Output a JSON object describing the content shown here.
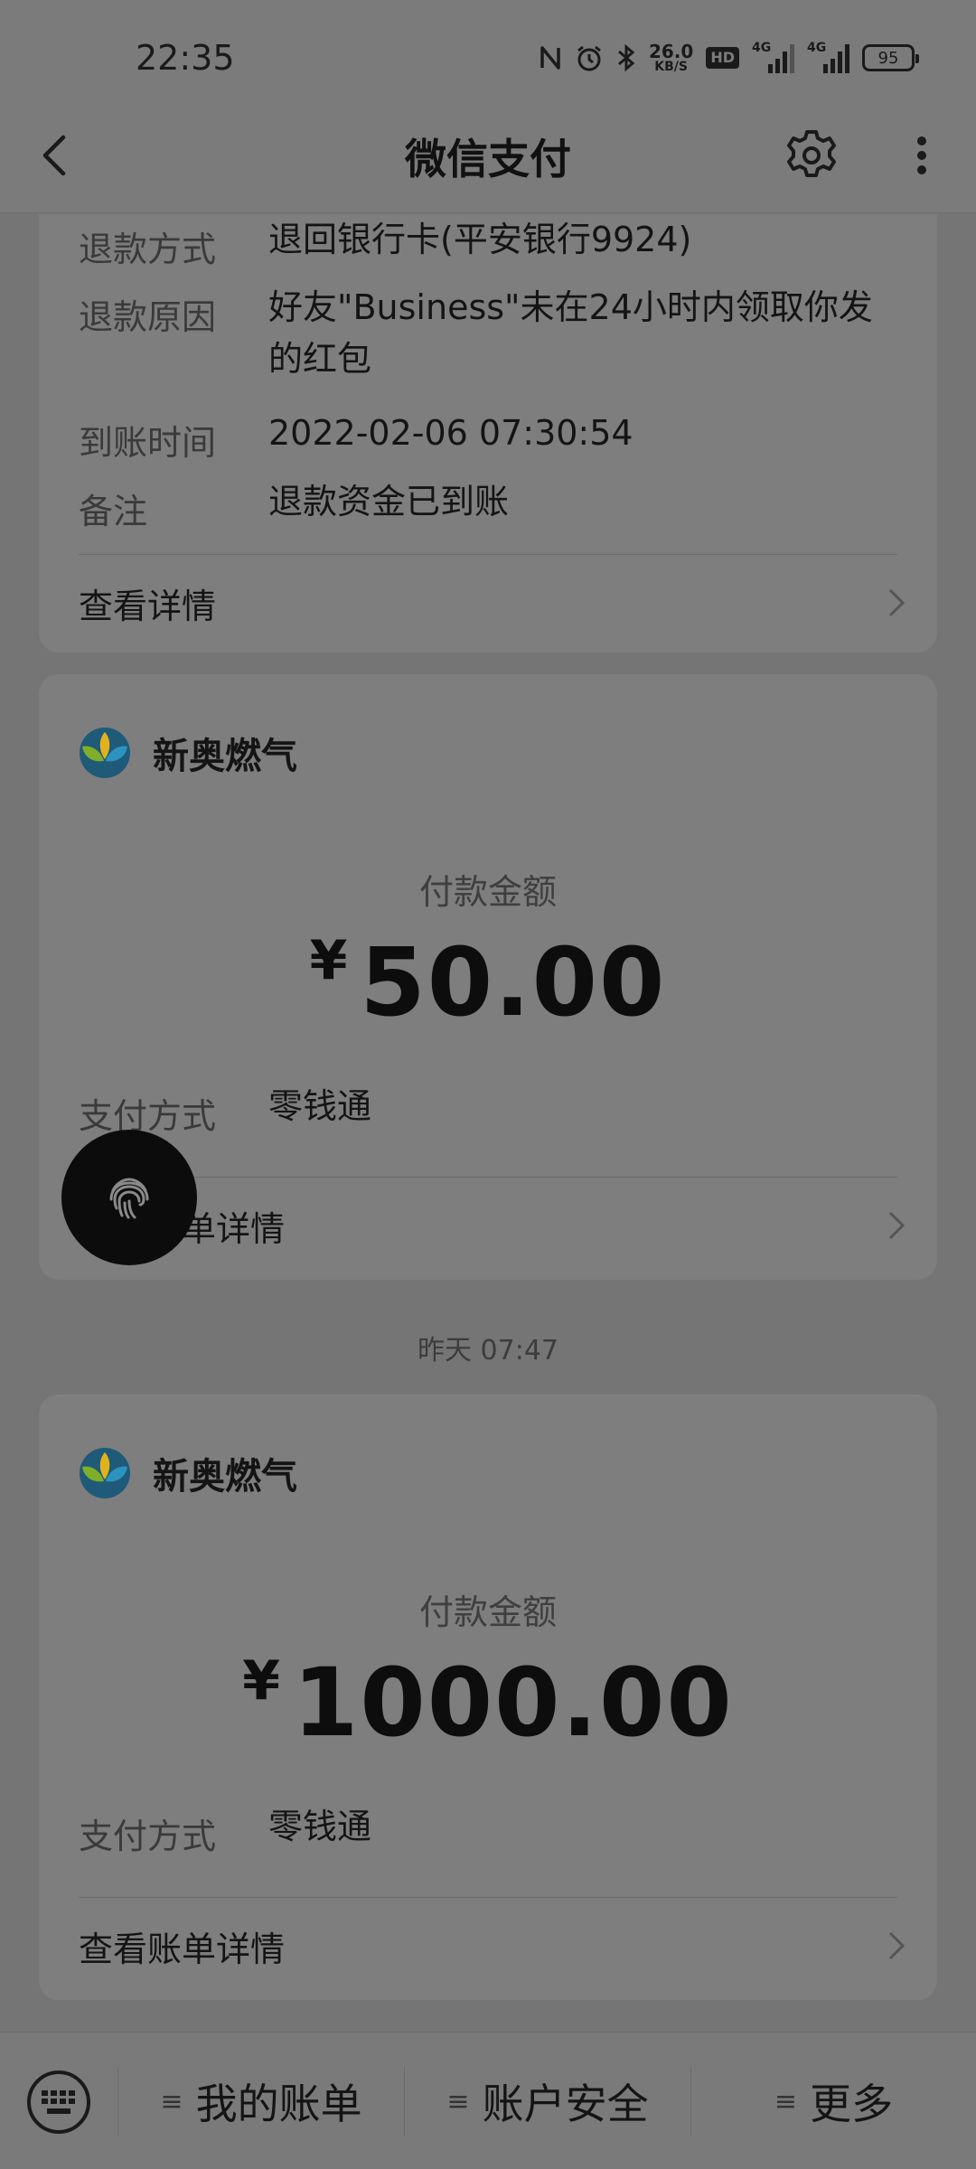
{
  "status_bar": {
    "time": "22:35",
    "net_speed_value": "26.0",
    "net_speed_unit": "KB/S",
    "hd_badge": "HD",
    "signal1_tag": "4G",
    "signal2_tag": "4G",
    "battery_level": "95",
    "icons": [
      "nfc-icon",
      "alarm-icon",
      "bluetooth-icon",
      "net-speed",
      "hd-icon",
      "signal-icon",
      "signal-icon",
      "battery-icon"
    ]
  },
  "header": {
    "title": "微信支付",
    "back_icon": "back-arrow-icon",
    "settings_icon": "gear-icon",
    "more_icon": "more-vertical-icon"
  },
  "refund_card": {
    "rows": [
      {
        "label": "退款方式",
        "value": "退回银行卡(平安银行9924)"
      },
      {
        "label": "退款原因",
        "value": "好友\"Business\"未在24小时内领取你发的红包"
      },
      {
        "label": "到账时间",
        "value": "2022-02-06 07:30:54"
      },
      {
        "label": "备注",
        "value": "退款资金已到账"
      }
    ],
    "link": "查看详情"
  },
  "payment_card_1": {
    "merchant": "新奥燃气",
    "amount_label": "付款金额",
    "currency": "¥",
    "amount": "50.00",
    "method_label": "支付方式",
    "method_value": "零钱通",
    "link": "查看账单详情"
  },
  "timestamp": "昨天 07:47",
  "payment_card_2": {
    "merchant": "新奥燃气",
    "amount_label": "付款金额",
    "currency": "¥",
    "amount": "1000.00",
    "method_label": "支付方式",
    "method_value": "零钱通",
    "link": "查看账单详情"
  },
  "bottom_menu": {
    "items": [
      {
        "label": "我的账单"
      },
      {
        "label": "账户安全"
      },
      {
        "label": "更多"
      }
    ]
  },
  "colors": {
    "overlay_background": "#757575",
    "card_background": "#7e7e7e"
  }
}
